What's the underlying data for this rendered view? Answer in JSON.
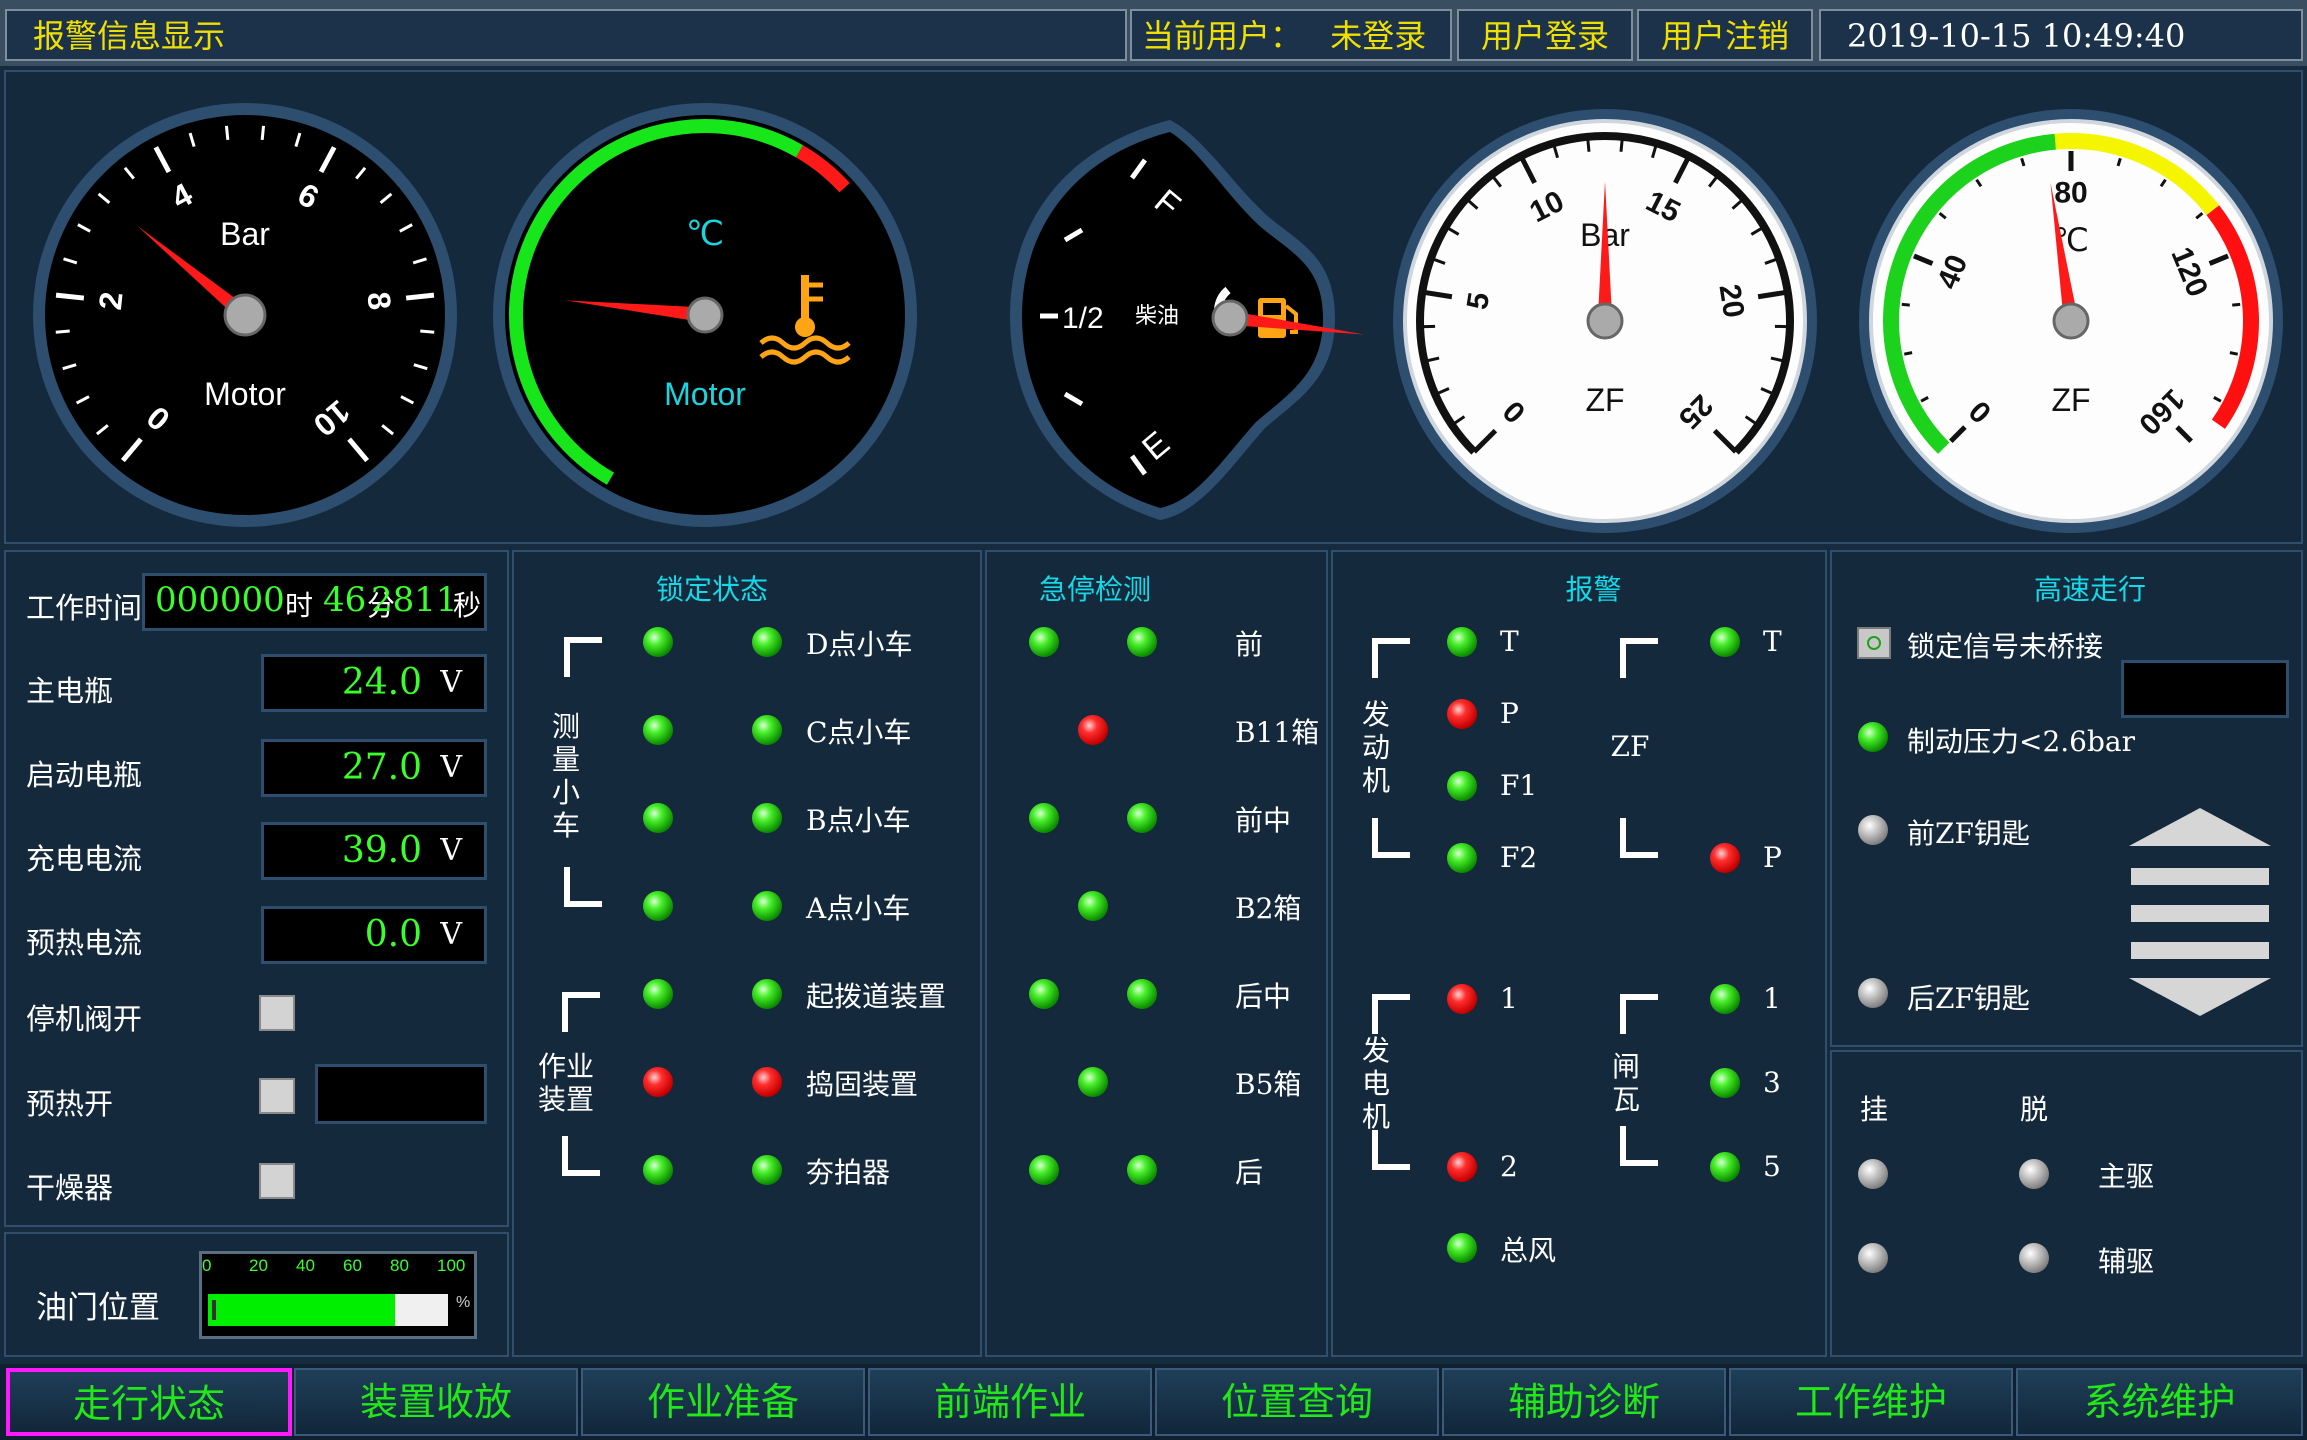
{
  "header": {
    "alarm_display": "报警信息显示",
    "current_user_label": "当前用户：",
    "current_user_value": "未登录",
    "login": "用户登录",
    "logout": "用户注销",
    "datetime": "2019-10-15 10:49:40"
  },
  "gauges": {
    "motor_pressure": {
      "unit_top": "Bar",
      "label_bottom": "Motor",
      "ticks": [
        "0",
        "2",
        "4",
        "6",
        "8",
        "10"
      ],
      "value": 3.2,
      "min": 0,
      "max": 10
    },
    "motor_temp": {
      "unit_top": "℃",
      "label_bottom": "Motor",
      "value_fraction": 0.22
    },
    "fuel": {
      "full": "F",
      "half": "1/2",
      "empty": "E",
      "label": "柴油",
      "value_fraction": 0.1
    },
    "zf_pressure": {
      "unit_top": "Bar",
      "label_bottom": "ZF",
      "ticks": [
        "0",
        "5",
        "10",
        "15",
        "20",
        "25"
      ],
      "value": 12.5,
      "min": 0,
      "max": 25
    },
    "zf_temp": {
      "unit_top": "℃",
      "label_bottom": "ZF",
      "ticks": [
        "0",
        "40",
        "80",
        "120",
        "160"
      ],
      "value": 75,
      "min": 0,
      "max": 160
    }
  },
  "left_panel": {
    "work_time_label": "工作时间",
    "work_time_hours": "000000",
    "hour_unit": "时",
    "work_time_minutes": "46",
    "minute_unit": "分",
    "work_time_seconds": "2811",
    "second_unit": "秒",
    "rows": [
      {
        "label": "主电瓶",
        "value": "24.0",
        "unit": "V"
      },
      {
        "label": "启动电瓶",
        "value": "27.0",
        "unit": "V"
      },
      {
        "label": "充电电流",
        "value": "39.0",
        "unit": "V"
      },
      {
        "label": "预热电流",
        "value": "0.0",
        "unit": "V"
      }
    ],
    "checks": [
      {
        "label": "停机阀开"
      },
      {
        "label": "预热开"
      },
      {
        "label": "干燥器"
      }
    ]
  },
  "throttle": {
    "label": "油门位置",
    "ticks": [
      "0",
      "20",
      "40",
      "60",
      "80",
      "100"
    ],
    "unit": "%",
    "value_percent": 78
  },
  "lock_status": {
    "title": "锁定状态",
    "group1": "测量小车",
    "group2": "作业装置",
    "rows": [
      {
        "label": "D点小车",
        "left": "g",
        "right": "g"
      },
      {
        "label": "C点小车",
        "left": "g",
        "right": "g"
      },
      {
        "label": "B点小车",
        "left": "g",
        "right": "g"
      },
      {
        "label": "A点小车",
        "left": "g",
        "right": "g"
      },
      {
        "label": "起拨道装置",
        "left": "g",
        "right": "g"
      },
      {
        "label": "捣固装置",
        "left": "r",
        "right": "r"
      },
      {
        "label": "夯拍器",
        "left": "g",
        "right": "g"
      }
    ]
  },
  "estop": {
    "title": "急停检测",
    "rows": [
      {
        "label": "前",
        "leds": [
          "g",
          "g"
        ]
      },
      {
        "label": "B11箱",
        "leds": [
          "r"
        ]
      },
      {
        "label": "前中",
        "leds": [
          "g",
          "g"
        ]
      },
      {
        "label": "B2箱",
        "leds": [
          "g"
        ]
      },
      {
        "label": "后中",
        "leds": [
          "g",
          "g"
        ]
      },
      {
        "label": "B5箱",
        "leds": [
          "g"
        ]
      },
      {
        "label": "后",
        "leds": [
          "g",
          "g"
        ]
      }
    ]
  },
  "alarm": {
    "title": "报警",
    "engine": "发动机",
    "generator": "发电机",
    "zf": "ZF",
    "brake": "闸瓦",
    "engine_items": [
      {
        "label": "T",
        "led": "g"
      },
      {
        "label": "P",
        "led": "r"
      },
      {
        "label": "F1",
        "led": "g"
      },
      {
        "label": "F2",
        "led": "g"
      }
    ],
    "zf_items": [
      {
        "label": "T",
        "led": "g"
      },
      {
        "label": "P",
        "led": "r"
      }
    ],
    "gen_items": [
      {
        "label": "1",
        "led": "r"
      },
      {
        "label": "2",
        "led": "r"
      }
    ],
    "brake_items": [
      {
        "label": "1",
        "led": "g"
      },
      {
        "label": "3",
        "led": "g"
      },
      {
        "label": "5",
        "led": "g"
      }
    ],
    "total_air": "总风",
    "total_air_led": "g"
  },
  "high_speed": {
    "title": "高速走行",
    "items": [
      {
        "label": "锁定信号未桥接",
        "led": "box"
      },
      {
        "label": "制动压力<2.6bar",
        "led": "g"
      },
      {
        "label": "前ZF钥匙",
        "led": "gy"
      },
      {
        "label": "后ZF钥匙",
        "led": "gy"
      }
    ]
  },
  "engage": {
    "hang": "挂",
    "release": "脱",
    "main": "主驱",
    "aux": "辅驱"
  },
  "nav": [
    "走行状态",
    "装置收放",
    "作业准备",
    "前端作业",
    "位置查询",
    "辅助诊断",
    "工作维护",
    "系统维护"
  ],
  "colors": {
    "accent_green": "#39ff2a",
    "title_cyan": "#14d9e8",
    "header_yellow": "#f0e000",
    "active_border": "#ff19ff"
  }
}
